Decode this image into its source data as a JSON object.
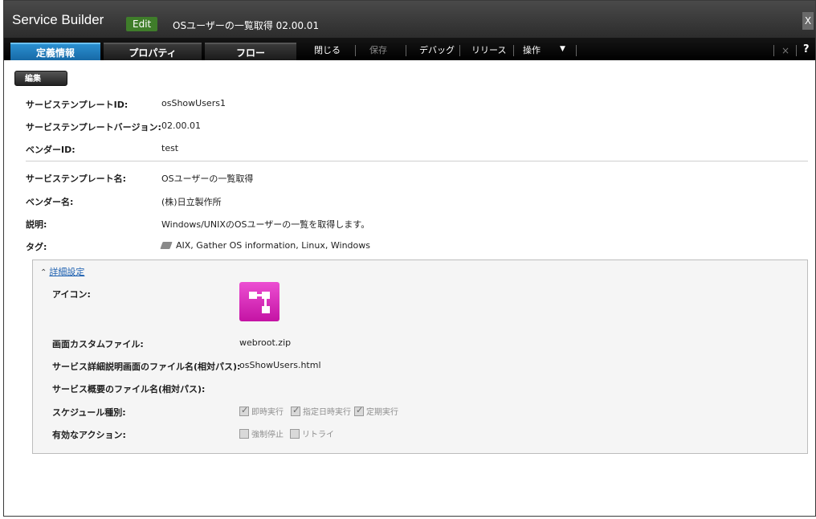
{
  "window": {
    "app_title": "Service Builder",
    "mode_badge": "Edit",
    "doc_title": "OSユーザーの一覧取得 02.00.01",
    "close_glyph": "X"
  },
  "tabs": [
    "定義情報",
    "プロパティ",
    "フロー"
  ],
  "toolbar": {
    "close": "閉じる",
    "save": "保存",
    "debug": "デバッグ",
    "release": "リリース",
    "operation": "操作",
    "operation_caret": "▼",
    "tools_icon": "×",
    "help": "?"
  },
  "edit_button": "編集",
  "form": {
    "rows": [
      {
        "label": "サービステンプレートID:",
        "value": "osShowUsers1"
      },
      {
        "label": "サービステンプレートバージョン:",
        "value": "02.00.01"
      },
      {
        "label": "ベンダーID:",
        "value": "test"
      },
      {
        "label": "サービステンプレート名:",
        "value": "OSユーザーの一覧取得"
      },
      {
        "label": "ベンダー名:",
        "value": "(株)日立製作所"
      },
      {
        "label": "説明:",
        "value": "Windows/UNIXのOSユーザーの一覧を取得します。"
      },
      {
        "label": "タグ:",
        "value": "AIX, Gather OS information, Linux, Windows"
      }
    ]
  },
  "detail": {
    "toggle_label": "詳細設定",
    "icon_label": "アイコン:",
    "screen_custom_file_label": "画面カスタムファイル:",
    "screen_custom_file_value": "webroot.zip",
    "detail_screen_file_label": "サービス詳細説明画面のファイル名(相対パス):",
    "detail_screen_file_value": "osShowUsers.html",
    "summary_file_label": "サービス概要のファイル名(相対パス):",
    "schedule_label": "スケジュール種別:",
    "schedule_options": [
      "即時実行",
      "指定日時実行",
      "定期実行"
    ],
    "actions_label": "有効なアクション:",
    "action_options": [
      "強制停止",
      "リトライ"
    ]
  },
  "colors": {
    "accent_tab": "#1f7fc3",
    "badge": "#3f7d2a",
    "icon": "#d52ab8",
    "link": "#1b5fb0"
  }
}
